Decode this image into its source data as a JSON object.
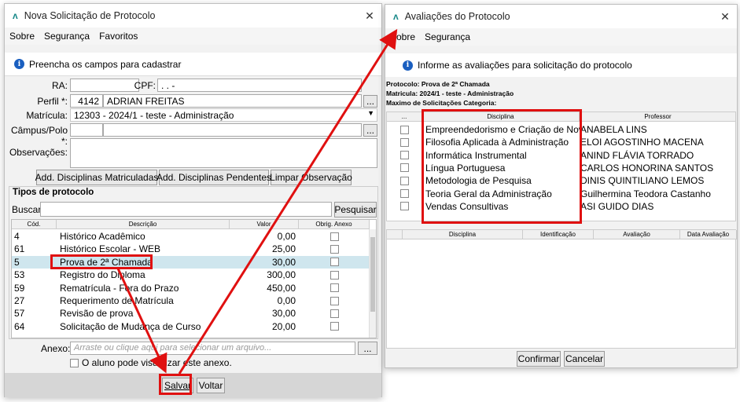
{
  "left": {
    "title": "Nova Solicitação de Protocolo",
    "menu": [
      "Sobre",
      "Segurança",
      "Favoritos"
    ],
    "info": "Preencha os campos para cadastrar",
    "ra_label": "RA:",
    "cpf_label": "CPF:",
    "cpf_value": ".   .   -",
    "perfil_label": "Perfil *:",
    "perfil_code": "4142",
    "perfil_name": "ADRIAN FREITAS",
    "matricula_label": "Matrícula:",
    "matricula_value": "12303 - 2024/1 - teste - Administração",
    "campus_label": "Câmpus/Polo *:",
    "obs_label": "Observações:",
    "btn_matriculadas": "Add. Disciplinas Matriculadas",
    "btn_pendentes": "Add. Disciplinas Pendentes",
    "btn_limpar": "Limpar Observação",
    "tipos_title": "Tipos de protocolo",
    "buscar_label": "Buscar:",
    "pesquisar": "Pesquisar",
    "cols": [
      "Cód.",
      "Descrição",
      "Valor",
      "Obrig. Anexo"
    ],
    "rows": [
      {
        "cod": "4",
        "desc": "Histórico Acadêmico",
        "valor": "0,00"
      },
      {
        "cod": "61",
        "desc": "Histórico Escolar - WEB",
        "valor": "25,00"
      },
      {
        "cod": "5",
        "desc": "Prova de 2ª Chamada",
        "valor": "30,00"
      },
      {
        "cod": "53",
        "desc": "Registro do Diploma",
        "valor": "300,00"
      },
      {
        "cod": "59",
        "desc": "Rematrícula - Fora do Prazo",
        "valor": "450,00"
      },
      {
        "cod": "27",
        "desc": "Requerimento de Matrícula",
        "valor": "0,00"
      },
      {
        "cod": "57",
        "desc": "Revisão de prova",
        "valor": "30,00"
      },
      {
        "cod": "64",
        "desc": "Solicitação de Mudança de Curso",
        "valor": "20,00"
      }
    ],
    "anexo_label": "Anexo:",
    "anexo_placeholder": "Arraste ou clique aqui para selecionar um arquivo...",
    "visualizar": "O aluno pode visualizar este anexo.",
    "salvar": "Salvar",
    "voltar": "Voltar",
    "browse": "..."
  },
  "right": {
    "title": "Avaliações do Protocolo",
    "menu": [
      "Sobre",
      "Segurança"
    ],
    "info": "Informe as avaliações para solicitação do protocolo",
    "protocolo": "Protocolo: Prova de 2ª Chamada",
    "matricula": "Matricula: 2024/1 - teste - Administração",
    "maximo": "Maximo de Solicitações Categoria:",
    "cols": [
      "...",
      "Disciplina",
      "Professor"
    ],
    "rows": [
      {
        "disc": "Empreendedorismo e Criação de Nov...",
        "prof": "ANABELA LINS"
      },
      {
        "disc": "Filosofia Aplicada à Administração",
        "prof": "ELOI AGOSTINHO MACENA"
      },
      {
        "disc": "Informática Instrumental",
        "prof": "ANIND FLÁVIA TORRADO"
      },
      {
        "disc": "Língua Portuguesa",
        "prof": "CARLOS HONORINA SANTOS"
      },
      {
        "disc": "Metodologia de Pesquisa",
        "prof": "DINIS QUINTILIANO LEMOS"
      },
      {
        "disc": "Teoria Geral da Administração",
        "prof": "Guilhermina Teodora Castanho"
      },
      {
        "disc": "Vendas Consultivas",
        "prof": "ASI GUIDO DIAS"
      }
    ],
    "cols2": [
      "",
      "Disciplina",
      "Identificação",
      "Avaliação",
      "Data Avaliação"
    ],
    "confirmar": "Confirmar",
    "cancelar": "Cancelar"
  },
  "colors": {
    "highlight": "#cfe6ee",
    "annotation": "#e01010"
  }
}
